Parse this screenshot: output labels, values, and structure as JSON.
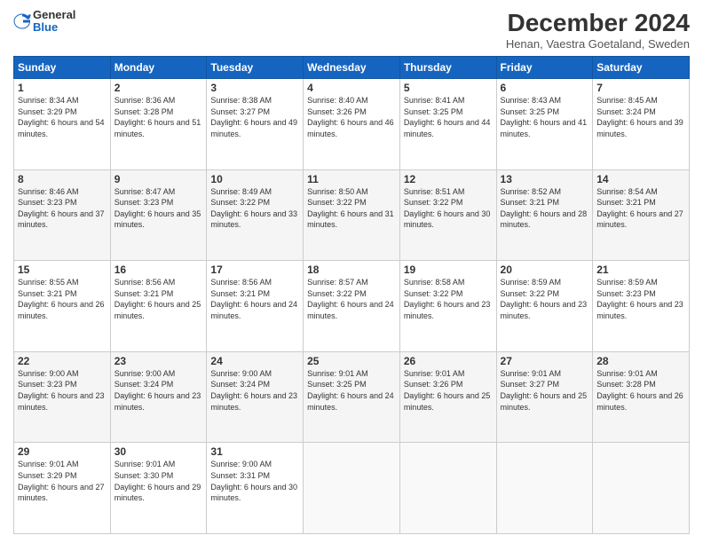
{
  "header": {
    "logo_general": "General",
    "logo_blue": "Blue",
    "title": "December 2024",
    "subtitle": "Henan, Vaestra Goetaland, Sweden"
  },
  "weekdays": [
    "Sunday",
    "Monday",
    "Tuesday",
    "Wednesday",
    "Thursday",
    "Friday",
    "Saturday"
  ],
  "weeks": [
    [
      {
        "day": "1",
        "sunrise": "8:34 AM",
        "sunset": "3:29 PM",
        "daylight": "6 hours and 54 minutes."
      },
      {
        "day": "2",
        "sunrise": "8:36 AM",
        "sunset": "3:28 PM",
        "daylight": "6 hours and 51 minutes."
      },
      {
        "day": "3",
        "sunrise": "8:38 AM",
        "sunset": "3:27 PM",
        "daylight": "6 hours and 49 minutes."
      },
      {
        "day": "4",
        "sunrise": "8:40 AM",
        "sunset": "3:26 PM",
        "daylight": "6 hours and 46 minutes."
      },
      {
        "day": "5",
        "sunrise": "8:41 AM",
        "sunset": "3:25 PM",
        "daylight": "6 hours and 44 minutes."
      },
      {
        "day": "6",
        "sunrise": "8:43 AM",
        "sunset": "3:25 PM",
        "daylight": "6 hours and 41 minutes."
      },
      {
        "day": "7",
        "sunrise": "8:45 AM",
        "sunset": "3:24 PM",
        "daylight": "6 hours and 39 minutes."
      }
    ],
    [
      {
        "day": "8",
        "sunrise": "8:46 AM",
        "sunset": "3:23 PM",
        "daylight": "6 hours and 37 minutes."
      },
      {
        "day": "9",
        "sunrise": "8:47 AM",
        "sunset": "3:23 PM",
        "daylight": "6 hours and 35 minutes."
      },
      {
        "day": "10",
        "sunrise": "8:49 AM",
        "sunset": "3:22 PM",
        "daylight": "6 hours and 33 minutes."
      },
      {
        "day": "11",
        "sunrise": "8:50 AM",
        "sunset": "3:22 PM",
        "daylight": "6 hours and 31 minutes."
      },
      {
        "day": "12",
        "sunrise": "8:51 AM",
        "sunset": "3:22 PM",
        "daylight": "6 hours and 30 minutes."
      },
      {
        "day": "13",
        "sunrise": "8:52 AM",
        "sunset": "3:21 PM",
        "daylight": "6 hours and 28 minutes."
      },
      {
        "day": "14",
        "sunrise": "8:54 AM",
        "sunset": "3:21 PM",
        "daylight": "6 hours and 27 minutes."
      }
    ],
    [
      {
        "day": "15",
        "sunrise": "8:55 AM",
        "sunset": "3:21 PM",
        "daylight": "6 hours and 26 minutes."
      },
      {
        "day": "16",
        "sunrise": "8:56 AM",
        "sunset": "3:21 PM",
        "daylight": "6 hours and 25 minutes."
      },
      {
        "day": "17",
        "sunrise": "8:56 AM",
        "sunset": "3:21 PM",
        "daylight": "6 hours and 24 minutes."
      },
      {
        "day": "18",
        "sunrise": "8:57 AM",
        "sunset": "3:22 PM",
        "daylight": "6 hours and 24 minutes."
      },
      {
        "day": "19",
        "sunrise": "8:58 AM",
        "sunset": "3:22 PM",
        "daylight": "6 hours and 23 minutes."
      },
      {
        "day": "20",
        "sunrise": "8:59 AM",
        "sunset": "3:22 PM",
        "daylight": "6 hours and 23 minutes."
      },
      {
        "day": "21",
        "sunrise": "8:59 AM",
        "sunset": "3:23 PM",
        "daylight": "6 hours and 23 minutes."
      }
    ],
    [
      {
        "day": "22",
        "sunrise": "9:00 AM",
        "sunset": "3:23 PM",
        "daylight": "6 hours and 23 minutes."
      },
      {
        "day": "23",
        "sunrise": "9:00 AM",
        "sunset": "3:24 PM",
        "daylight": "6 hours and 23 minutes."
      },
      {
        "day": "24",
        "sunrise": "9:00 AM",
        "sunset": "3:24 PM",
        "daylight": "6 hours and 23 minutes."
      },
      {
        "day": "25",
        "sunrise": "9:01 AM",
        "sunset": "3:25 PM",
        "daylight": "6 hours and 24 minutes."
      },
      {
        "day": "26",
        "sunrise": "9:01 AM",
        "sunset": "3:26 PM",
        "daylight": "6 hours and 25 minutes."
      },
      {
        "day": "27",
        "sunrise": "9:01 AM",
        "sunset": "3:27 PM",
        "daylight": "6 hours and 25 minutes."
      },
      {
        "day": "28",
        "sunrise": "9:01 AM",
        "sunset": "3:28 PM",
        "daylight": "6 hours and 26 minutes."
      }
    ],
    [
      {
        "day": "29",
        "sunrise": "9:01 AM",
        "sunset": "3:29 PM",
        "daylight": "6 hours and 27 minutes."
      },
      {
        "day": "30",
        "sunrise": "9:01 AM",
        "sunset": "3:30 PM",
        "daylight": "6 hours and 29 minutes."
      },
      {
        "day": "31",
        "sunrise": "9:00 AM",
        "sunset": "3:31 PM",
        "daylight": "6 hours and 30 minutes."
      },
      null,
      null,
      null,
      null
    ]
  ]
}
